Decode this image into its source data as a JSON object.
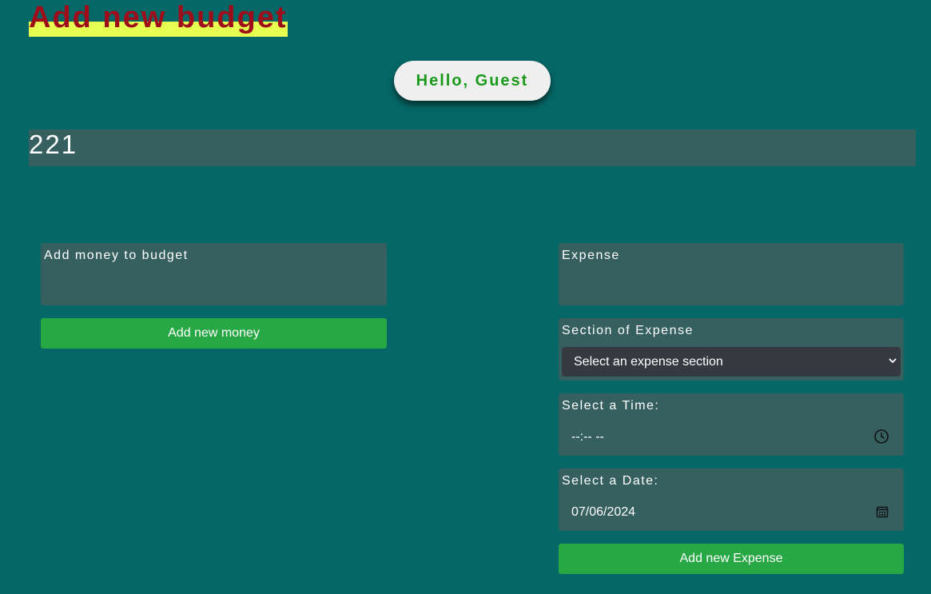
{
  "page_title": "Add new budget",
  "greeting": "Hello, Guest",
  "budget_total": "221",
  "add_money": {
    "label": "Add money to budget",
    "button_label": "Add new money"
  },
  "expense": {
    "label": "Expense",
    "section_label": "Section of Expense",
    "section_selected": "Select an expense section",
    "time_label": "Select a Time:",
    "time_value": "--:-- --",
    "date_label": "Select a Date:",
    "date_value": "07/06/2024",
    "button_label": "Add new Expense"
  },
  "icons": {
    "time": "clock-icon",
    "date": "calendar-icon",
    "select": "chevron-down-icon"
  },
  "colors": {
    "background": "#056766",
    "title_text": "#a00d1a",
    "title_highlight": "#e6ff50",
    "panel": "#365f60",
    "button": "#28a745",
    "greeting_text": "#1a9a1a",
    "select_bg": "#363a40"
  }
}
